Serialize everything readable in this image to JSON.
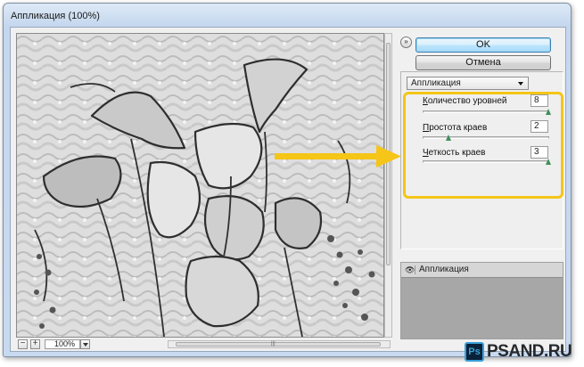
{
  "window": {
    "title": "Аппликация (100%)"
  },
  "dialog": {
    "ok_label": "OK",
    "cancel_label": "Отмена",
    "collapse_glyph": "»"
  },
  "filter": {
    "selected": "Аппликация",
    "params": [
      {
        "label_mnemonic": "К",
        "label_rest": "оличество уровней",
        "value": "8",
        "fraction": 1.0
      },
      {
        "label_mnemonic": "П",
        "label_rest": "ростота краев",
        "value": "2",
        "fraction": 0.2
      },
      {
        "label_mnemonic": "Ч",
        "label_rest": "еткость краев",
        "value": "3",
        "fraction": 1.0
      }
    ]
  },
  "zoom": {
    "value": "100%",
    "minus": "−",
    "plus": "+"
  },
  "layers": {
    "items": [
      {
        "name": "Аппликация"
      }
    ]
  },
  "watermark": {
    "logo_text": "Ps",
    "text": "PSAND.RU"
  },
  "colors": {
    "highlight": "#f5c518",
    "ok_border": "#3c7fb1",
    "slider_thumb": "#3f8f5a"
  },
  "icons": {
    "eye": "eye-icon",
    "collapse": "double-chevron-icon",
    "dropdown": "chevron-down-icon"
  }
}
